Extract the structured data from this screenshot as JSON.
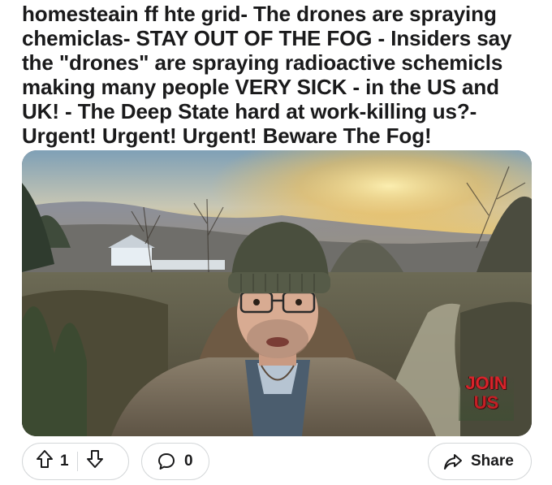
{
  "post": {
    "title": "homesteain ff hte grid- The drones are spraying chemiclas- STAY OUT OF THE FOG - Insiders say the \"drones\" are spraying radioactive schemicls making many people VERY SICK - in the US and UK! - The Deep State hard at work-killing us?- Urgent! Urgent! Urgent! Beware The Fog!"
  },
  "video": {
    "overlay_line1": "JOIN",
    "overlay_line2": "US"
  },
  "actions": {
    "upvote_icon": "arrow-up-icon",
    "vote_count": "1",
    "downvote_icon": "arrow-down-icon",
    "comment_icon": "speech-bubble-icon",
    "comment_count": "0",
    "share_icon": "share-arrow-icon",
    "share_label": "Share"
  }
}
